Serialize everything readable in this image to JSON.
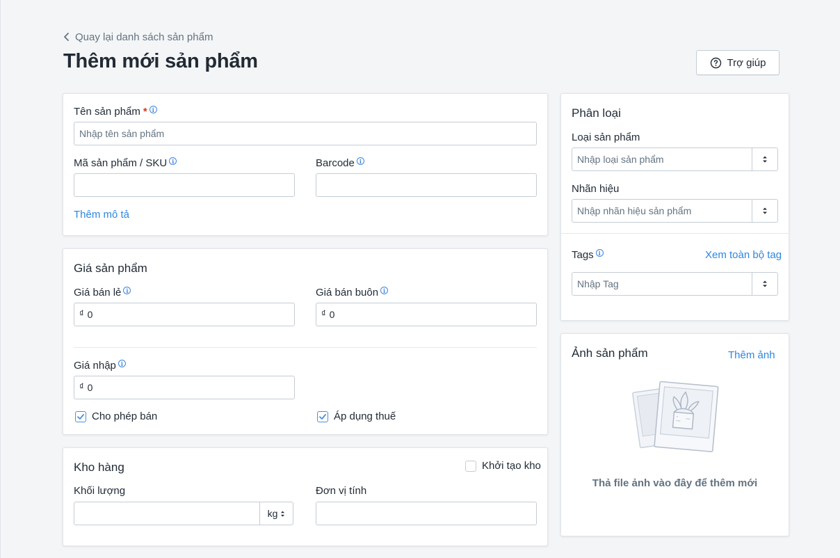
{
  "header": {
    "back_label": "Quay lại danh sách sản phẩm",
    "title": "Thêm mới sản phẩm",
    "help_label": "Trợ giúp"
  },
  "general": {
    "name_label": "Tên sản phẩm",
    "name_required": "*",
    "name_placeholder": "Nhập tên sản phẩm",
    "sku_label": "Mã sản phẩm / SKU",
    "sku_value": "",
    "barcode_label": "Barcode",
    "barcode_value": "",
    "add_description": "Thêm mô tả"
  },
  "pricing": {
    "title": "Giá sản phẩm",
    "retail_label": "Giá bán lẻ",
    "retail_currency": "₫",
    "retail_value": "0",
    "wholesale_label": "Giá bán buôn",
    "wholesale_currency": "₫",
    "wholesale_value": "0",
    "cost_label": "Giá nhập",
    "cost_currency": "₫",
    "cost_value": "0",
    "allow_sale_label": "Cho phép bán",
    "allow_sale_checked": true,
    "apply_tax_label": "Áp dụng thuế",
    "apply_tax_checked": true
  },
  "inventory": {
    "title": "Kho hàng",
    "init_stock_label": "Khởi tạo kho",
    "init_stock_checked": false,
    "weight_label": "Khối lượng",
    "weight_value": "",
    "weight_unit": "kg",
    "unit_label": "Đơn vị tính",
    "unit_value": ""
  },
  "classification": {
    "title": "Phân loại",
    "type_label": "Loại sản phẩm",
    "type_placeholder": "Nhập loại sản phẩm",
    "brand_label": "Nhãn hiệu",
    "brand_placeholder": "Nhập nhãn hiệu sản phẩm",
    "tags_label": "Tags",
    "view_all_tags": "Xem toàn bộ tag",
    "tags_placeholder": "Nhập Tag"
  },
  "images": {
    "title": "Ảnh sản phẩm",
    "add_image": "Thêm ảnh",
    "drop_text": "Thả file ảnh vào đây để thêm mới"
  },
  "colors": {
    "link": "#2e86e0",
    "required": "#de3618",
    "checkbox": "#4a8fdf",
    "background": "#f4f5f7"
  }
}
